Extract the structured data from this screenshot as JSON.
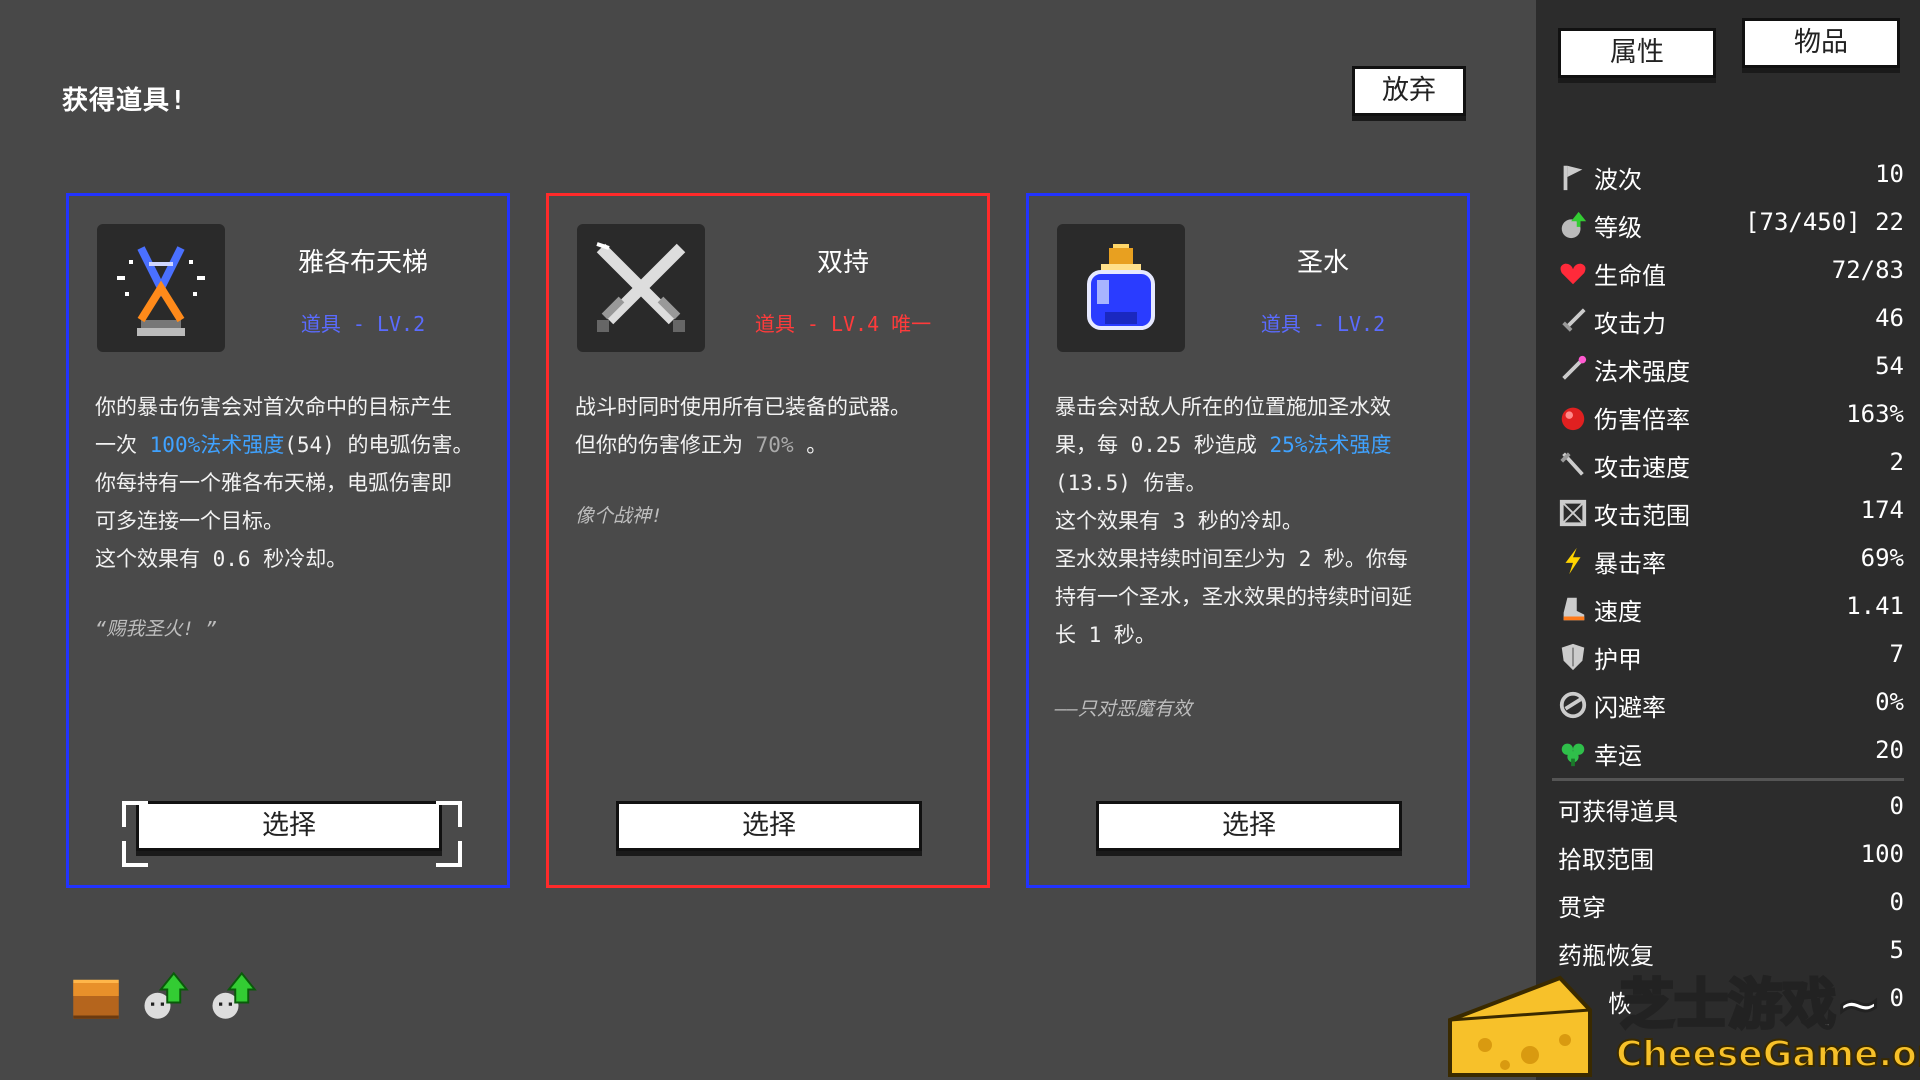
{
  "header": {
    "title": "获得道具!",
    "giveup_label": "放弃"
  },
  "cards": [
    {
      "name": "雅各布天梯",
      "meta": "道具 - LV.2",
      "desc": [
        [
          "你的暴击伤害会对首次命中的目标产生",
          ""
        ],
        [
          "一次 ",
          "100%法术强度",
          "(54) 的电弧伤害。"
        ],
        [
          "你每持有一个雅各布天梯，电弧伤害即",
          ""
        ],
        [
          "可多连接一个目标。",
          ""
        ],
        [
          "这个效果有 0.6 秒冷却。",
          ""
        ]
      ],
      "quote": "“赐我圣火! ”",
      "select_label": "选择",
      "icon": "jacobs-ladder-icon",
      "border_color": "#2233ff"
    },
    {
      "name": "双持",
      "meta": "道具 - LV.4 唯一",
      "desc": [
        [
          "战斗时同时使用所有已装备的武器。"
        ],
        [
          "但你的伤害修正为 ",
          "70%",
          " 。"
        ]
      ],
      "quote": "像个战神!",
      "select_label": "选择",
      "icon": "crossed-swords-icon",
      "border_color": "#ff2a2a"
    },
    {
      "name": "圣水",
      "meta": "道具 - LV.2",
      "desc": [
        [
          "暴击会对敌人所在的位置施加圣水效"
        ],
        [
          "果，每 0.25 秒造成 ",
          "25%法术强度"
        ],
        [
          "(13.5) 伤害。"
        ],
        [
          "这个效果有 3 秒的冷却。"
        ],
        [
          "圣水效果持续时间至少为 2 秒。你每"
        ],
        [
          "持有一个圣水，圣水效果的持续时间延"
        ],
        [
          "长 1 秒。"
        ]
      ],
      "quote": "——只对恶魔有效",
      "select_label": "选择",
      "icon": "holy-water-icon",
      "border_color": "#2233ff"
    }
  ],
  "side_panel": {
    "tab_attributes": "属性",
    "tab_items": "物品",
    "stats": [
      {
        "icon": "flag-icon",
        "label": "波次",
        "value": "10"
      },
      {
        "icon": "level-up-icon",
        "label": "等级",
        "value": "[73/450] 22"
      },
      {
        "icon": "heart-icon",
        "label": "生命值",
        "value": "72/83"
      },
      {
        "icon": "sword-icon",
        "label": "攻击力",
        "value": "46"
      },
      {
        "icon": "wand-icon",
        "label": "法术强度",
        "value": "54"
      },
      {
        "icon": "damage-multiplier-icon",
        "label": "伤害倍率",
        "value": "163%"
      },
      {
        "icon": "attack-speed-icon",
        "label": "攻击速度",
        "value": "2"
      },
      {
        "icon": "range-icon",
        "label": "攻击范围",
        "value": "174"
      },
      {
        "icon": "lightning-icon",
        "label": "暴击率",
        "value": "69%"
      },
      {
        "icon": "boot-icon",
        "label": "速度",
        "value": "1.41"
      },
      {
        "icon": "shield-icon",
        "label": "护甲",
        "value": "7"
      },
      {
        "icon": "dodge-icon",
        "label": "闪避率",
        "value": "0%"
      },
      {
        "icon": "clover-icon",
        "label": "幸运",
        "value": "20"
      }
    ],
    "extra_stats": [
      {
        "label": "可获得道具",
        "value": "0"
      },
      {
        "label": "拾取范围",
        "value": "100"
      },
      {
        "label": "贯穿",
        "value": "0"
      },
      {
        "label": "药瓶恢复",
        "value": "5"
      },
      {
        "label": "恢",
        "value": "0"
      }
    ]
  },
  "inventory_strip": [
    "chest-icon",
    "upgrade-icon",
    "upgrade-icon"
  ],
  "watermark": {
    "cn": "芝士游戏~",
    "en": "CheeseGame.org"
  }
}
